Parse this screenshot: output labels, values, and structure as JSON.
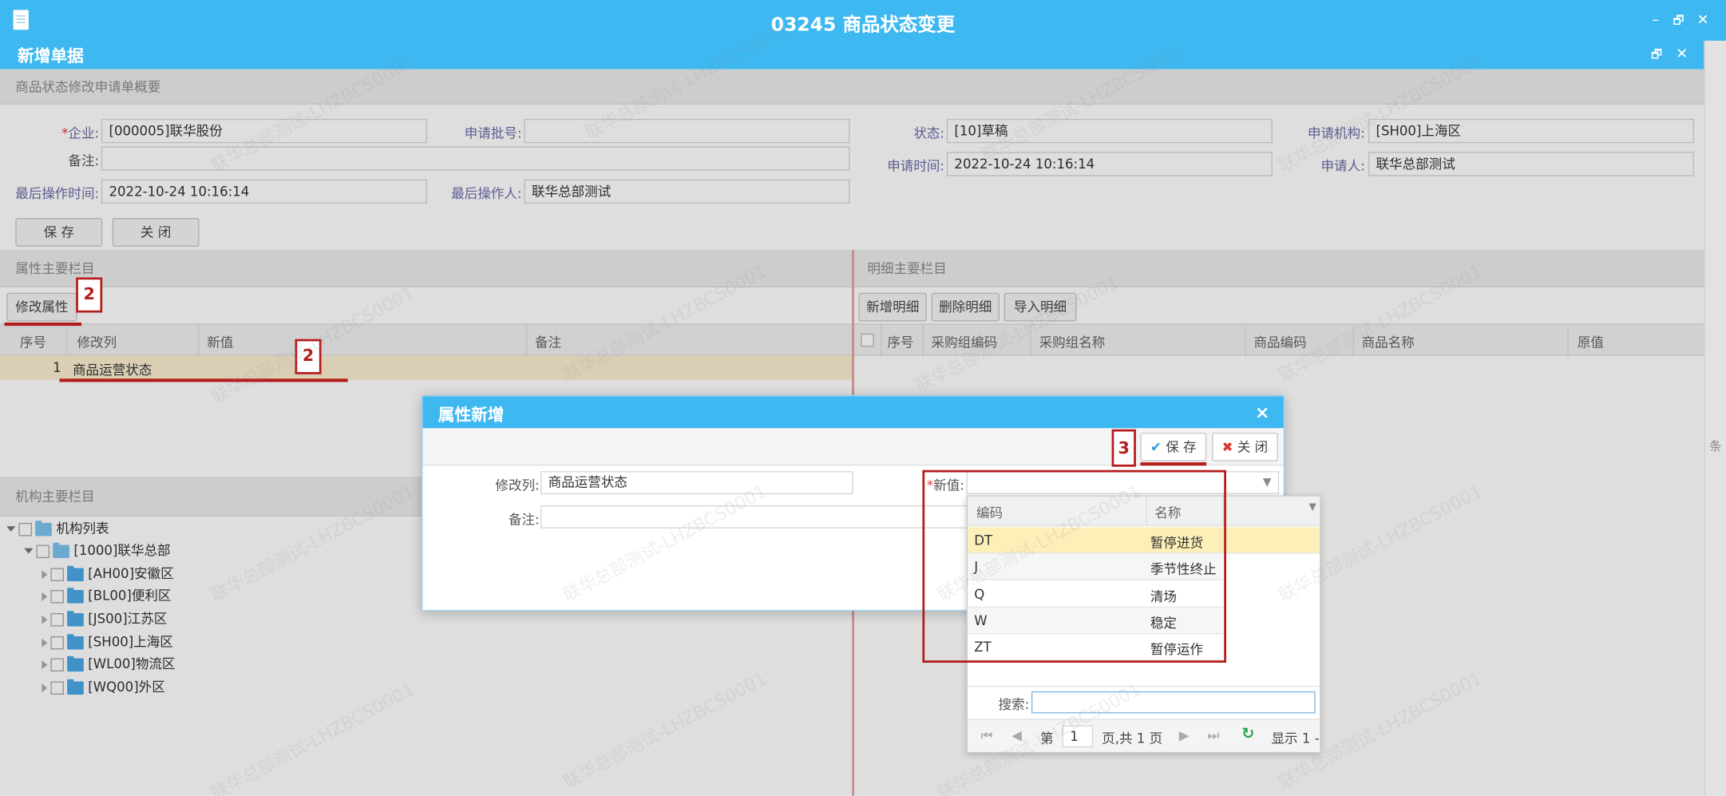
{
  "window": {
    "title": "03245 商品状态变更",
    "subtitle": "新增单据",
    "minimize": "–",
    "restore": "🗗",
    "close": "✕"
  },
  "summary": {
    "panel_title": "商品状态修改申请单概要",
    "company_label": "企业:",
    "company_value": "[000005]联华股份",
    "batch_label": "申请批号:",
    "batch_value": "",
    "status_label": "状态:",
    "status_value": "[10]草稿",
    "org_label": "申请机构:",
    "org_value": "[SH00]上海区",
    "remark_label": "备注:",
    "remark_value": "",
    "apply_time_label": "申请时间:",
    "apply_time_value": "2022-10-24 10:16:14",
    "applicant_label": "申请人:",
    "applicant_value": "联华总部测试",
    "last_op_time_label": "最后操作时间:",
    "last_op_time_value": "2022-10-24 10:16:14",
    "last_op_user_label": "最后操作人:",
    "last_op_user_value": "联华总部测试",
    "save_label": "保 存",
    "close_label": "关 闭"
  },
  "attr_panel": {
    "title": "属性主要栏目",
    "modify_button": "修改属性",
    "columns": [
      "序号",
      "修改列",
      "新值",
      "备注"
    ],
    "rows": [
      {
        "index": "1",
        "column": "商品运营状态",
        "new_value": "",
        "remark": ""
      }
    ]
  },
  "detail_panel": {
    "title": "明细主要栏目",
    "buttons": [
      "新增明细",
      "删除明细",
      "导入明细"
    ],
    "columns": [
      "序号",
      "采购组编码",
      "采购组名称",
      "商品编码",
      "商品名称",
      "原值"
    ]
  },
  "org_panel": {
    "title": "机构主要栏目",
    "root": "机构列表",
    "hq": "[1000]联华总部",
    "children": [
      "[AH00]安徽区",
      "[BL00]便利区",
      "[JS00]江苏区",
      "[SH00]上海区",
      "[WL00]物流区",
      "[WQ00]外区"
    ]
  },
  "dialog": {
    "title": "属性新增",
    "close": "×",
    "save_label": "保 存",
    "close_label": "关 闭",
    "modify_col_label": "修改列:",
    "modify_col_value": "商品运营状态",
    "new_value_label": "新值:",
    "remark_label": "备注:"
  },
  "dropdown": {
    "columns": [
      "编码",
      "名称"
    ],
    "options": [
      {
        "code": "DT",
        "name": "暂停进货"
      },
      {
        "code": "J",
        "name": "季节性终止"
      },
      {
        "code": "Q",
        "name": "清场"
      },
      {
        "code": "W",
        "name": "稳定"
      },
      {
        "code": "ZT",
        "name": "暂停运作"
      }
    ],
    "search_label": "搜索:",
    "page_prefix": "第",
    "page_value": "1",
    "page_suffix": "页,共 1 页",
    "display_info": "显示 1 -"
  },
  "annotations": {
    "step2": "2",
    "step3": "3"
  },
  "watermark": "联华总部测试-LHZBCS0001",
  "right_strip_text": "条",
  "colors": {
    "header": "#3db8f0",
    "annotation": "#b51c1c",
    "selected_row": "#fbeecf",
    "highlight_row": "#fdefb8"
  }
}
